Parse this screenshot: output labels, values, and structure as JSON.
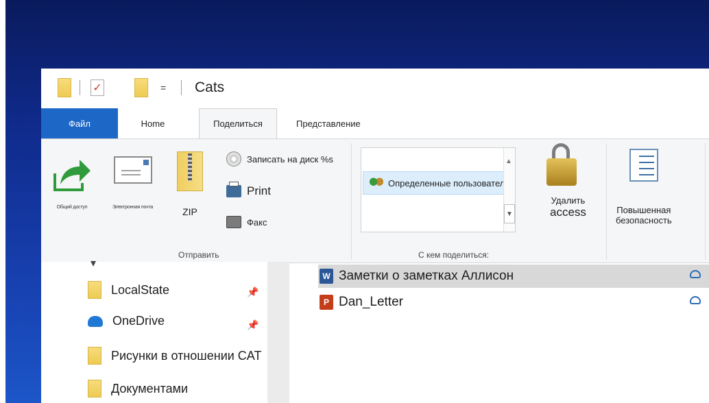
{
  "window": {
    "title": "Cats",
    "qa_menu": "="
  },
  "tabs": {
    "file": "Файл",
    "home": "Home",
    "share": "Поделиться",
    "view": "Представление"
  },
  "ribbon": {
    "send": {
      "share_label": "Общий доступ",
      "email_label": "Электронная почта",
      "zip_label": "ZIP",
      "burn_label": "Записать на диск %s",
      "print_label": "Print",
      "fax_label": "Факс",
      "group_label": "Отправить"
    },
    "share_with": {
      "selected_entry": "Определенные пользователи",
      "remove_access_line1": "Удалить",
      "remove_access_line2": "access",
      "advanced_security_line1": "Повышенная",
      "advanced_security_line2": "безопасность",
      "group_label": "С кем поделиться:"
    }
  },
  "nav": {
    "items": [
      {
        "label": "LocalState",
        "pinned": true
      },
      {
        "label": "OneDrive",
        "pinned": true
      },
      {
        "label": "Рисунки в отношении CAT",
        "pinned": false
      },
      {
        "label": "Документами",
        "pinned": false
      }
    ]
  },
  "files": [
    {
      "name": "Заметки о заметках Аллисон",
      "type": "word",
      "selected": true
    },
    {
      "name": "Dan_Letter",
      "type": "powerpoint",
      "selected": false
    }
  ],
  "icons": {
    "word": "W",
    "powerpoint": "P",
    "pin": "📌",
    "scroll_up": "▲",
    "scroll_down": "▼",
    "nav_up": "▾",
    "check": "✓"
  },
  "colors": {
    "file_tab": "#1d68c7",
    "desktop_top": "#0a1a5c",
    "desktop_bottom": "#1c56c8"
  }
}
